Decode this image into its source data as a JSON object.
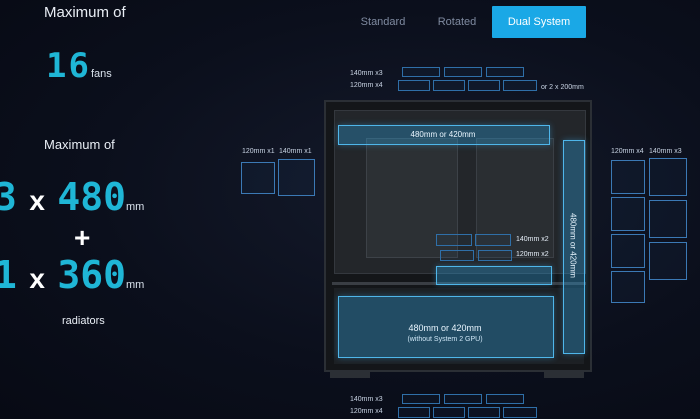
{
  "left": {
    "fans_heading": "Maximum of",
    "fans_count": "16",
    "fans_unit": "fans",
    "rad_heading": "Maximum of",
    "rad_line1_qty": "3",
    "rad_line1_x": "x",
    "rad_line1_size": "480",
    "rad_line1_unit": "mm",
    "plus": "+",
    "rad_line2_qty": "1",
    "rad_line2_x": "x",
    "rad_line2_size": "360",
    "rad_line2_unit": "mm",
    "rad_footer": "radiators"
  },
  "tabs": [
    {
      "label": "Standard",
      "active": false
    },
    {
      "label": "Rotated",
      "active": false
    },
    {
      "label": "Dual System",
      "active": true
    }
  ],
  "diagram": {
    "top_140": "140mm x3",
    "top_120": "120mm x4",
    "top_200": "or 2 x 200mm",
    "side_120": "120mm x1",
    "side_140": "140mm x1",
    "right_120": "120mm x4",
    "right_140": "140mm x3",
    "top_rad": "480mm or 420mm",
    "vertical_rad": "480mm or 420mm",
    "mid_140": "140mm x2",
    "mid_120": "120mm x2",
    "bottom_rad": "480mm or 420mm",
    "bottom_rad_note": "(without System 2 GPU)",
    "bottom_140": "140mm x3",
    "bottom_120": "120mm x4"
  },
  "colors": {
    "accent": "#1aa8e6",
    "cyan_text": "#1fb6d6",
    "background": "#0b0f1c",
    "radiator_fill": "#2da0dc"
  }
}
